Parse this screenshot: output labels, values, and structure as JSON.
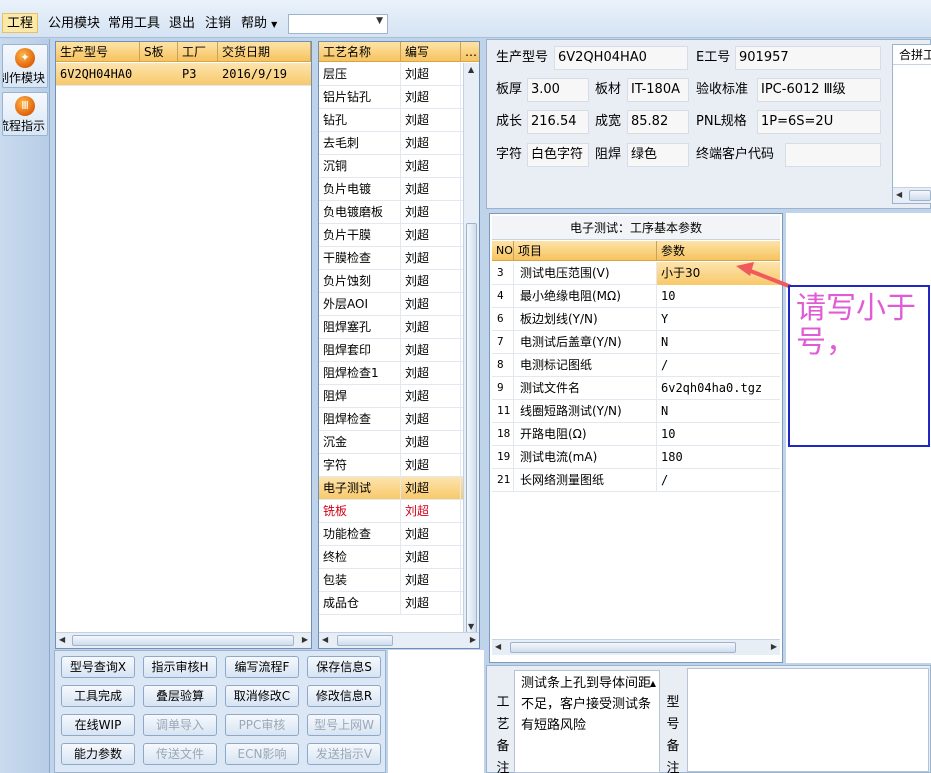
{
  "menu": {
    "items": [
      "工程",
      "公用模块",
      "常用工具",
      "退出",
      "注销",
      "帮助"
    ],
    "combo_value": ""
  },
  "sidebar": {
    "buttons": [
      {
        "label": "制作模块",
        "icon": "manufacture-icon"
      },
      {
        "label": "流程指示",
        "icon": "process-icon"
      }
    ]
  },
  "parts_table": {
    "headers": [
      "生产型号",
      "S板",
      "工厂",
      "交货日期"
    ],
    "rows": [
      {
        "model": "6V2QH04HA0",
        "s_board": "",
        "factory": "P3",
        "date": "2016/9/19"
      }
    ]
  },
  "process_table": {
    "headers": [
      "工艺名称",
      "编写",
      "…"
    ],
    "selected": "电子测试",
    "rows": [
      {
        "name": "层压",
        "author": "刘超"
      },
      {
        "name": "铝片钻孔",
        "author": "刘超"
      },
      {
        "name": "钻孔",
        "author": "刘超"
      },
      {
        "name": "去毛刺",
        "author": "刘超"
      },
      {
        "name": "沉铜",
        "author": "刘超"
      },
      {
        "name": "负片电镀",
        "author": "刘超"
      },
      {
        "name": "负电镀磨板",
        "author": "刘超"
      },
      {
        "name": "负片干膜",
        "author": "刘超"
      },
      {
        "name": "干膜检查",
        "author": "刘超"
      },
      {
        "name": "负片蚀刻",
        "author": "刘超"
      },
      {
        "name": "外层AOI",
        "author": "刘超"
      },
      {
        "name": "阻焊塞孔",
        "author": "刘超"
      },
      {
        "name": "阻焊套印",
        "author": "刘超"
      },
      {
        "name": "阻焊检查1",
        "author": "刘超"
      },
      {
        "name": "阻焊",
        "author": "刘超"
      },
      {
        "name": "阻焊检查",
        "author": "刘超"
      },
      {
        "name": "沉金",
        "author": "刘超"
      },
      {
        "name": "字符",
        "author": "刘超"
      },
      {
        "name": "电子测试",
        "author": "刘超"
      },
      {
        "name": "铣板",
        "author": "刘超",
        "red": true
      },
      {
        "name": "功能检查",
        "author": "刘超"
      },
      {
        "name": "终检",
        "author": "刘超"
      },
      {
        "name": "包装",
        "author": "刘超"
      },
      {
        "name": "成品仓",
        "author": "刘超"
      }
    ]
  },
  "buttons": [
    [
      "型号查询X",
      "指示审核H",
      "编写流程F",
      "保存信息S"
    ],
    [
      "工具完成",
      "叠层验算",
      "取消修改C",
      "修改信息R"
    ],
    [
      "在线WIP",
      "调单导入",
      "PPC审核",
      "型号上网W"
    ],
    [
      "能力参数",
      "传送文件",
      "ECN影响",
      "发送指示V"
    ]
  ],
  "buttons_disabled": [
    [
      false,
      false,
      false,
      false
    ],
    [
      false,
      false,
      false,
      false
    ],
    [
      false,
      true,
      true,
      true
    ],
    [
      false,
      true,
      true,
      true
    ]
  ],
  "info": {
    "model_label": "生产型号",
    "model_value": "6V2QH04HA0",
    "eng_label": "E工号",
    "eng_value": "901957",
    "thickness_label": "板厚",
    "thickness_value": "3.00",
    "material_label": "板材",
    "material_value": "IT-180A",
    "standard_label": "验收标准",
    "standard_value": "IPC-6012 Ⅲ级",
    "length_label": "成长",
    "length_value": "216.54",
    "width_label": "成宽",
    "width_value": "85.82",
    "pnl_label": "PNL规格",
    "pnl_value": "1P=6S=2U",
    "char_label": "字符",
    "char_value": "白色字符",
    "solder_label": "阻焊",
    "solder_value": "绿色",
    "customer_label": "终端客户代码",
    "customer_value": "",
    "merge_label": "合拼工"
  },
  "params": {
    "title": "电子测试：工序基本参数",
    "headers": [
      "NO",
      "项目",
      "参数"
    ],
    "rows": [
      {
        "no": "3",
        "item": "测试电压范围(V)",
        "value": "小于30",
        "selected": true
      },
      {
        "no": "4",
        "item": "最小绝缘电阻(MΩ)",
        "value": "10"
      },
      {
        "no": "6",
        "item": "板边划线(Y/N)",
        "value": "Y"
      },
      {
        "no": "7",
        "item": "电测试后盖章(Y/N)",
        "value": "N"
      },
      {
        "no": "8",
        "item": "电测标记图纸",
        "value": "/"
      },
      {
        "no": "9",
        "item": "测试文件名",
        "value": "6v2qh04ha0.tgz"
      },
      {
        "no": "11",
        "item": "线圈短路测试(Y/N)",
        "value": "N"
      },
      {
        "no": "18",
        "item": "开路电阻(Ω)",
        "value": "10"
      },
      {
        "no": "19",
        "item": "测试电流(mA)",
        "value": "180"
      },
      {
        "no": "21",
        "item": "长网络测量图纸",
        "value": "/"
      }
    ]
  },
  "annotation": {
    "text": "请写小于号，",
    "color": "#e05cd6"
  },
  "remarks": {
    "label": "工艺备注",
    "text": "测试条上孔到导体间距不足，客户接受测试条有短路风险",
    "model_label": "型号备注"
  }
}
